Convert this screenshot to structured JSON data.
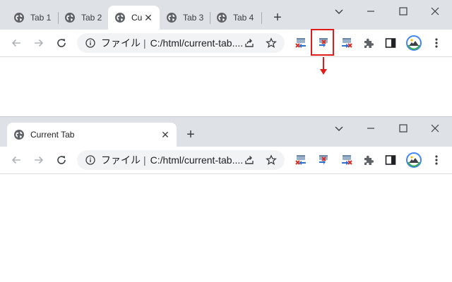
{
  "top_window": {
    "tabs": [
      {
        "label": "Tab 1",
        "active": false
      },
      {
        "label": "Tab 2",
        "active": false
      },
      {
        "label": "Cu",
        "active": true
      },
      {
        "label": "Tab 3",
        "active": false
      },
      {
        "label": "Tab 4",
        "active": false
      }
    ],
    "new_tab_glyph": "+",
    "close_glyph": "✕",
    "address": {
      "site_label": "ファイル",
      "separator": "|",
      "url": "C:/html/current-tab...."
    }
  },
  "bottom_window": {
    "tabs": [
      {
        "label": "Current Tab",
        "active": true
      }
    ],
    "new_tab_glyph": "+",
    "close_glyph": "✕",
    "address": {
      "site_label": "ファイル",
      "separator": "|",
      "url": "C:/html/current-tab...."
    }
  },
  "icons": {
    "tab_favicon": "globe-icon",
    "back": "arrow-left-icon",
    "forward": "arrow-right-icon",
    "reload": "reload-icon",
    "site_info": "info-icon",
    "share": "share-icon",
    "bookmark": "star-icon",
    "extension_close_left": "close-left-tabs-icon",
    "extension_close_others": "close-other-tabs-icon",
    "extension_close_right": "close-right-tabs-icon",
    "extensions": "puzzle-icon",
    "side_panel": "side-panel-icon",
    "profile": "profile-avatar-icon",
    "menu": "kebab-menu-icon",
    "minimize": "minimize-icon",
    "maximize": "maximize-icon",
    "close_window": "close-window-icon",
    "tab_search": "chevron-down-icon"
  },
  "annotation": {
    "highlight_color": "#e01b1b",
    "arrow_color": "#e01b1b"
  },
  "colors": {
    "tabstrip": "#dee1e6",
    "omnibox": "#f1f3f4",
    "text": "#202124",
    "icon": "#5f6368"
  }
}
